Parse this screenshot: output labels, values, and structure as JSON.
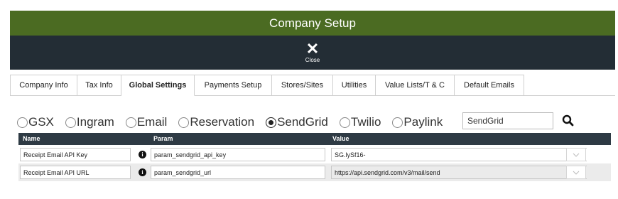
{
  "window": {
    "title": "Company Setup",
    "close_label": "Close"
  },
  "tabs": [
    {
      "label": "Company Info"
    },
    {
      "label": "Tax Info"
    },
    {
      "label": "Global Settings",
      "active": true
    },
    {
      "label": "Payments Setup"
    },
    {
      "label": "Stores/Sites"
    },
    {
      "label": "Utilities"
    },
    {
      "label": "Value Lists/T & C"
    },
    {
      "label": "Default Emails"
    }
  ],
  "radios": [
    {
      "label": "GSX",
      "checked": false
    },
    {
      "label": "Ingram",
      "checked": false
    },
    {
      "label": "Email",
      "checked": false
    },
    {
      "label": "Reservation",
      "checked": false
    },
    {
      "label": "SendGrid",
      "checked": true
    },
    {
      "label": "Twilio",
      "checked": false
    },
    {
      "label": "Paylink",
      "checked": false
    }
  ],
  "search": {
    "value": "SendGrid"
  },
  "table": {
    "headers": {
      "name": "Name",
      "param": "Param",
      "value": "Value"
    },
    "rows": [
      {
        "name": "Receipt Email API Key",
        "param": "param_sendgrid_api_key",
        "value": "SG.lySf16-"
      },
      {
        "name": "Receipt Email API URL",
        "param": "param_sendgrid_url",
        "value": "https://api.sendgrid.com/v3/mail/send"
      }
    ]
  },
  "colors": {
    "title_bar": "#4b6b22",
    "close_bar": "#232d35",
    "table_header": "#2e3a44"
  },
  "icons": {
    "close": "close-icon",
    "search": "search-icon",
    "info": "info-icon",
    "dropdown": "chevron-down-icon"
  }
}
